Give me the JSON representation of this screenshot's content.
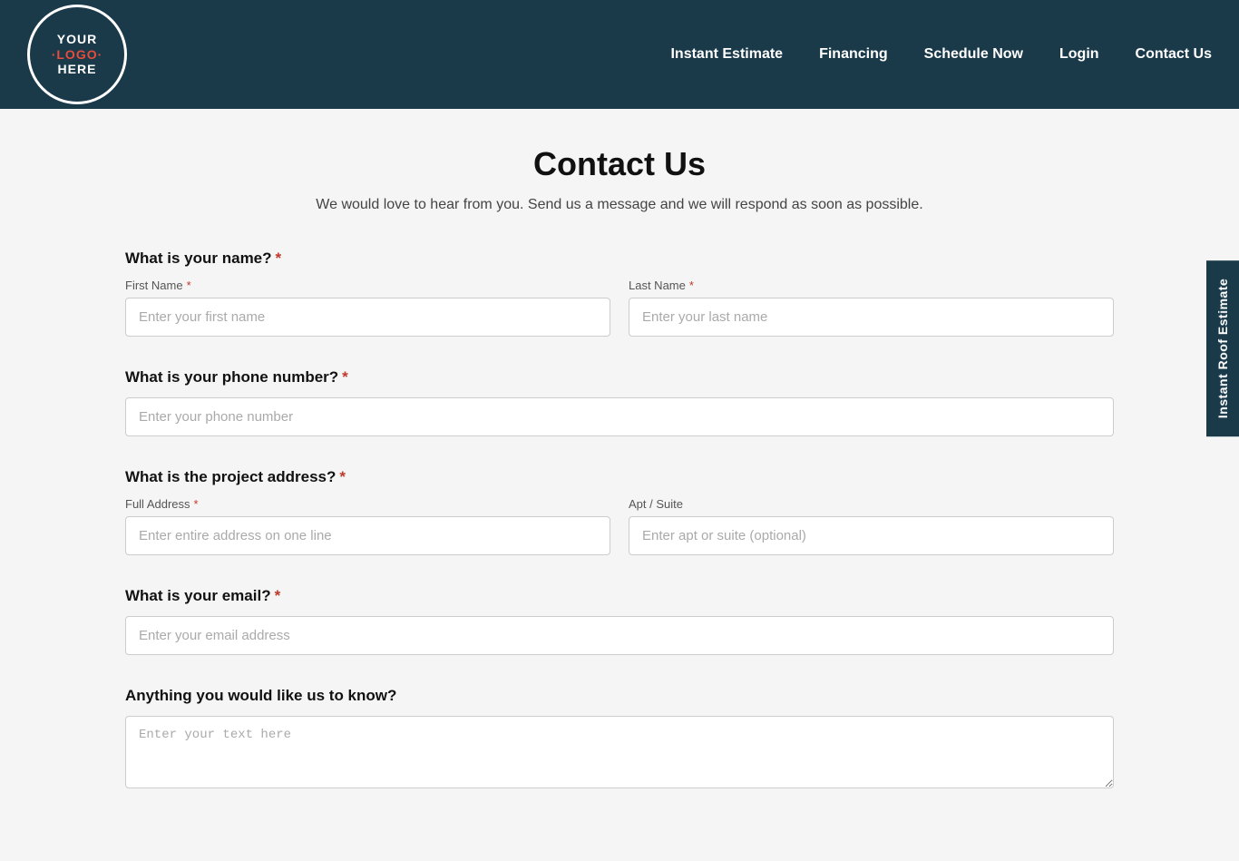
{
  "header": {
    "logo": {
      "line1": "YOUR",
      "line2": "·LOGO·",
      "line3": "HERE"
    },
    "nav": {
      "items": [
        {
          "label": "Instant Estimate"
        },
        {
          "label": "Financing"
        },
        {
          "label": "Schedule Now"
        },
        {
          "label": "Login"
        },
        {
          "label": "Contact Us"
        }
      ]
    }
  },
  "page": {
    "title": "Contact Us",
    "subtitle": "We would love to hear from you. Send us a message and we will respond as soon as possible."
  },
  "form": {
    "name_section": {
      "label": "What is your name?",
      "first_name_label": "First Name",
      "first_name_placeholder": "Enter your first name",
      "last_name_label": "Last Name",
      "last_name_placeholder": "Enter your last name"
    },
    "phone_section": {
      "label": "What is your phone number?",
      "phone_placeholder": "Enter your phone number"
    },
    "address_section": {
      "label": "What is the project address?",
      "full_address_label": "Full Address",
      "full_address_placeholder": "Enter entire address on one line",
      "apt_label": "Apt / Suite",
      "apt_placeholder": "Enter apt or suite (optional)"
    },
    "email_section": {
      "label": "What is your email?",
      "email_placeholder": "Enter your email address"
    },
    "notes_section": {
      "label": "Anything you would like us to know?",
      "notes_placeholder": "Enter your text here"
    }
  },
  "side_tab": {
    "label": "Instant Roof Estimate"
  }
}
